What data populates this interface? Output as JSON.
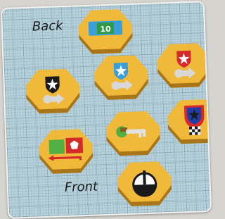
{
  "labels": {
    "back": "Back",
    "front": "Front"
  },
  "tiles": [
    {
      "name": "coin-10-tile",
      "value": "10"
    },
    {
      "name": "black-shield-star-arrow-tile"
    },
    {
      "name": "blue-shield-star-arrow-tile"
    },
    {
      "name": "red-shield-star-arrow-tile"
    },
    {
      "name": "flag-swap-tile"
    },
    {
      "name": "key-tile"
    },
    {
      "name": "checkered-shield-tile"
    },
    {
      "name": "compass-tile"
    }
  ],
  "colors": {
    "tile": "#f0b93a",
    "tile_side": "#a87618",
    "blue": "#3a9fd8",
    "red": "#d62a2a",
    "black": "#1a1a1a",
    "green": "#52b043"
  }
}
